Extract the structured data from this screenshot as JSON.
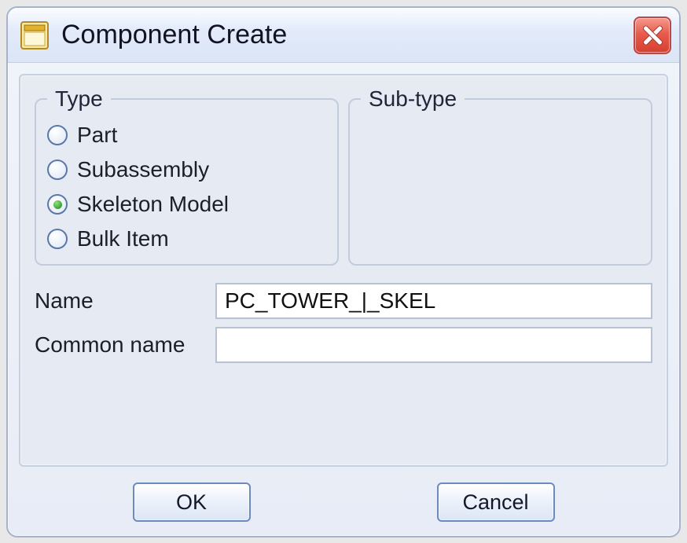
{
  "dialog": {
    "title": "Component Create",
    "icon": "assembly-window-icon"
  },
  "groups": {
    "type_legend": "Type",
    "subtype_legend": "Sub-type"
  },
  "type_options": [
    {
      "label": "Part",
      "selected": false
    },
    {
      "label": "Subassembly",
      "selected": false
    },
    {
      "label": "Skeleton Model",
      "selected": true
    },
    {
      "label": "Bulk Item",
      "selected": false
    }
  ],
  "fields": {
    "name_label": "Name",
    "name_value": "PC_TOWER_|_SKEL",
    "common_name_label": "Common name",
    "common_name_value": ""
  },
  "buttons": {
    "ok": "OK",
    "cancel": "Cancel"
  }
}
